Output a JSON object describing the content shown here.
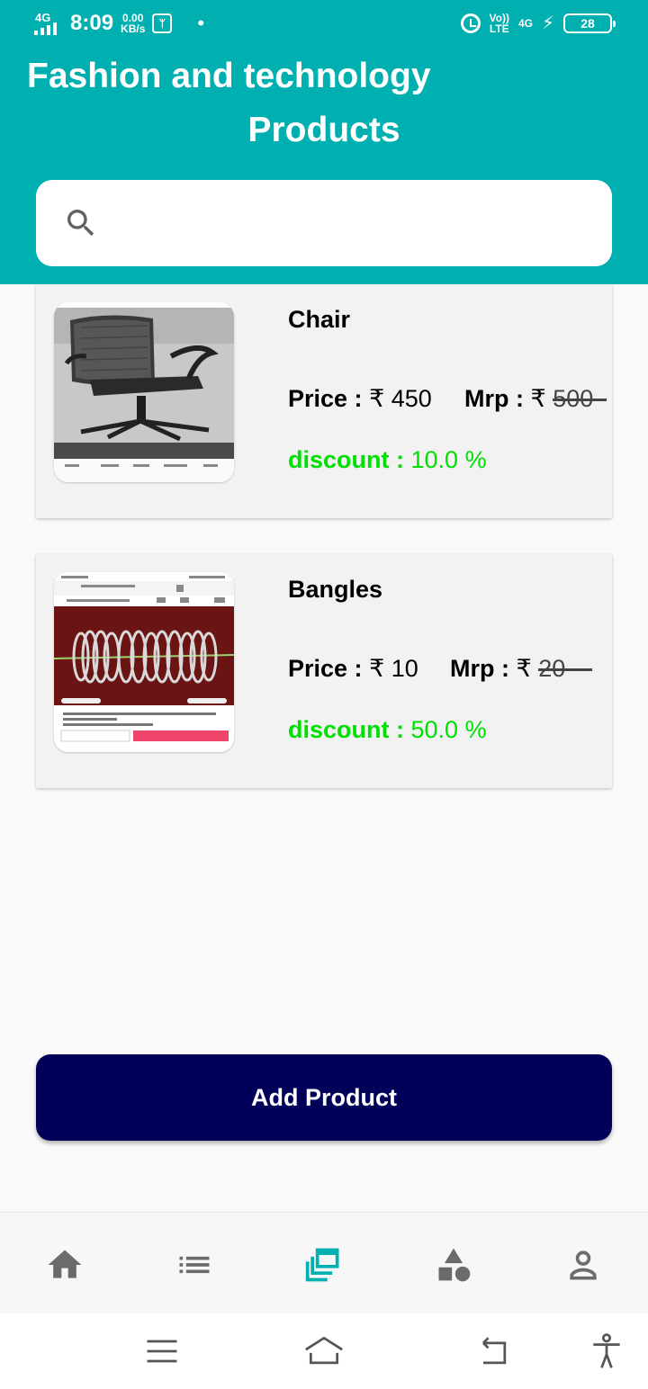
{
  "status_bar": {
    "network": "4G",
    "time": "8:09",
    "speed_value": "0.00",
    "speed_unit": "KB/s",
    "volte_top": "Vo))",
    "volte_bottom": "LTE",
    "net_right": "4G",
    "battery": "28"
  },
  "header": {
    "title": "Fashion and technology",
    "subtitle": "Products"
  },
  "search": {
    "placeholder": "",
    "value": ""
  },
  "products": [
    {
      "name": "Chair",
      "price_label": "Price :",
      "price": "₹ 450",
      "mrp_label": "Mrp :",
      "mrp_currency": "₹",
      "mrp": "500",
      "discount_label": "discount :",
      "discount": "10.0   %"
    },
    {
      "name": "Bangles",
      "price_label": "Price :",
      "price": "₹ 10",
      "mrp_label": "Mrp :",
      "mrp_currency": "₹",
      "mrp": "20",
      "discount_label": "discount :",
      "discount": "50.0   %"
    }
  ],
  "add_button": {
    "label": "Add Product"
  },
  "bottom_nav": {
    "items": [
      "home-icon",
      "list-icon",
      "collections-icon",
      "categories-icon",
      "profile-icon"
    ],
    "active_index": 2,
    "active_color": "#00b0b0",
    "inactive_color": "#6b6b6b"
  },
  "colors": {
    "header": "#00b0b0",
    "button": "#000058",
    "discount": "#00e000"
  }
}
